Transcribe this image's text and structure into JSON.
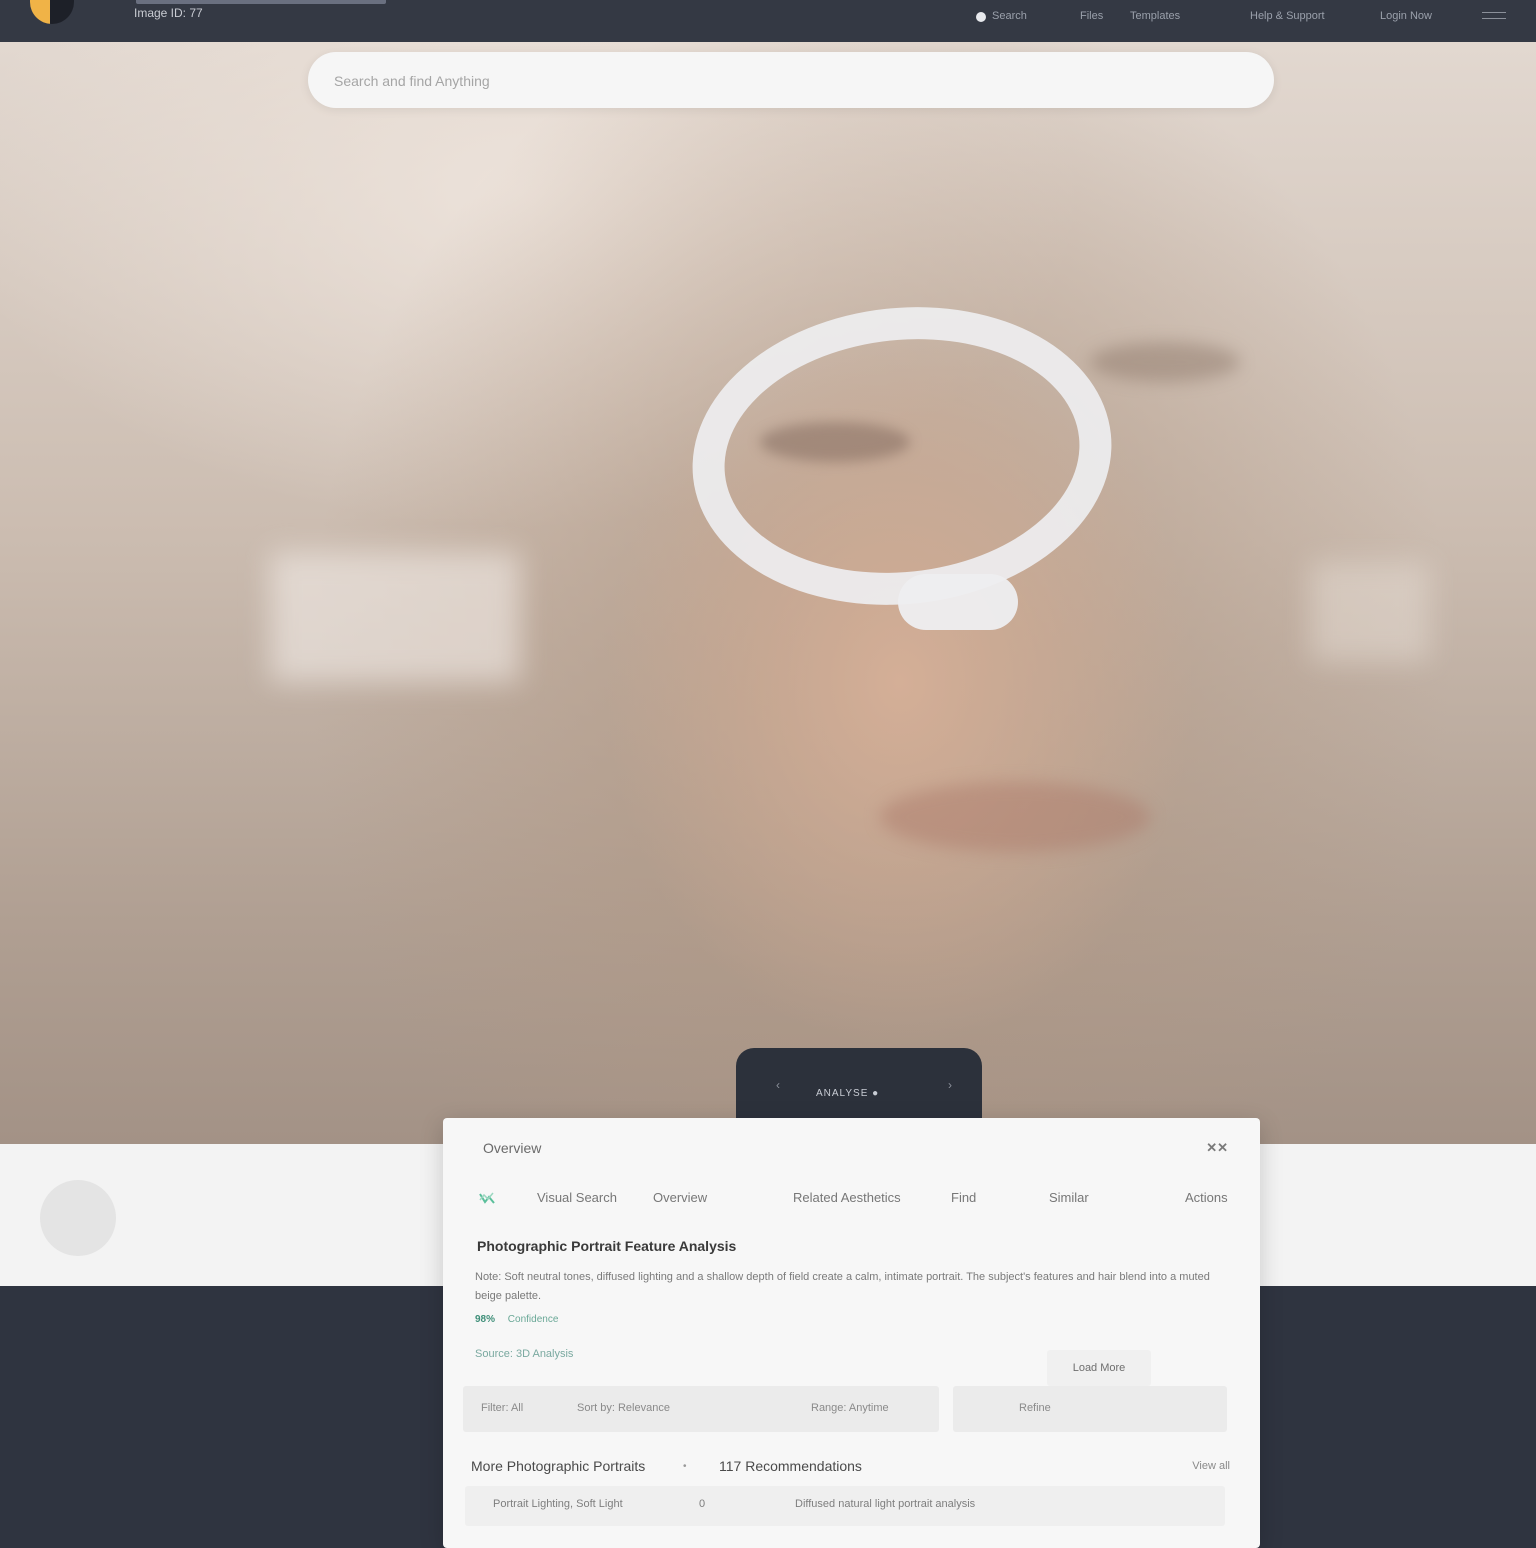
{
  "header": {
    "subtitle": "Image ID: 77",
    "nav": [
      "Search",
      "Files",
      "Templates",
      "Help & Support",
      "Login Now"
    ]
  },
  "search": {
    "placeholder": "Search and find Anything"
  },
  "hero": {
    "pill_text": "ANALYSE ●"
  },
  "card": {
    "title": "Overview",
    "close_label": "✕✕",
    "tabs": [
      "Visual Search",
      "Overview",
      "Related Aesthetics",
      "Find",
      "Similar",
      "Actions"
    ],
    "result": {
      "title": "Photographic Portrait Feature Analysis",
      "body": "Note: Soft neutral tones, diffused lighting and a shallow depth of field create a calm, intimate portrait. The subject's features and hair blend into a muted beige palette.",
      "meta_score": "98%",
      "meta_label": "Confidence",
      "meta_link": "Source: 3D Analysis"
    },
    "load_button": "Load More",
    "filters": [
      "Filter: All",
      "Sort by: Relevance",
      "Range: Anytime",
      "Refine"
    ],
    "section": {
      "title": "More Photographic Portraits",
      "count": "117 Recommendations",
      "link": "View all"
    },
    "row": [
      "Portrait Lighting, Soft Light",
      "0",
      "Diffused natural light portrait analysis"
    ]
  },
  "colors": {
    "topbar": "#343944",
    "accent": "#f0b347",
    "teal": "#3f8f79",
    "card": "#f7f7f7"
  }
}
